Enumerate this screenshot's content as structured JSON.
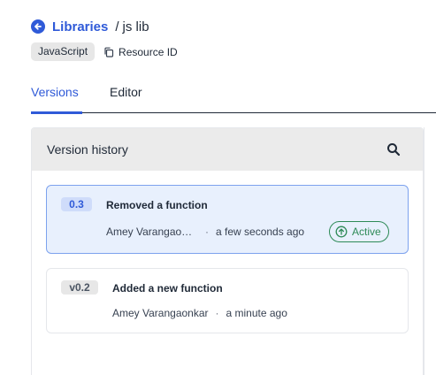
{
  "breadcrumb": {
    "parent_label": "Libraries",
    "separator": "/",
    "current": "js lib"
  },
  "library": {
    "language_badge": "JavaScript",
    "resource_id_label": "Resource ID"
  },
  "tabs": [
    {
      "label": "Versions",
      "selected": true
    },
    {
      "label": "Editor",
      "selected": false
    }
  ],
  "panel": {
    "title": "Version history"
  },
  "versions": [
    {
      "version": "0.3",
      "message": "Removed a function",
      "author": "Amey Varangaonkar",
      "separator": "·",
      "time": "a few seconds ago",
      "status": "Active"
    },
    {
      "version": "v0.2",
      "message": "Added a new function",
      "author": "Amey Varangaonkar",
      "separator": "·",
      "time": "a minute ago"
    }
  ],
  "colors": {
    "accent": "#2f5ad8",
    "active_status": "#2e8a57",
    "active_card_bg": "#e8f0fd",
    "header_bg": "#ebebeb"
  },
  "icons": {
    "back": "arrow-left-circle-icon",
    "copy": "copy-icon",
    "search": "search-icon",
    "active": "arrow-up-circle-icon"
  }
}
